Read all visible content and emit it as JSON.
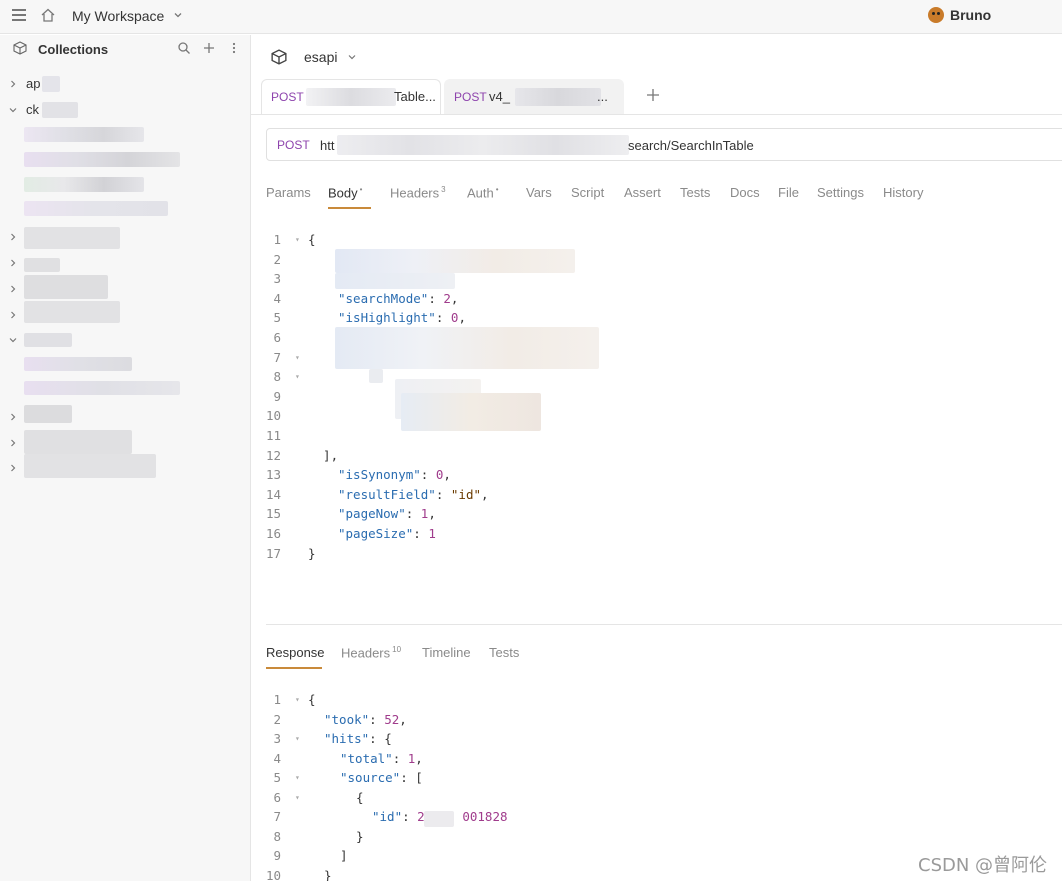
{
  "topbar": {
    "workspace": "My Workspace",
    "brand": "Bruno"
  },
  "sidebar": {
    "title": "Collections",
    "items": [
      {
        "label": "ap",
        "expanded": false
      },
      {
        "label": "ck",
        "expanded": true
      }
    ]
  },
  "collection": {
    "name": "esapi"
  },
  "tabs": [
    {
      "method": "POST",
      "title": "Table...",
      "active": true
    },
    {
      "method": "POST",
      "title": "v4_",
      "title_suffix": "...",
      "active": false
    }
  ],
  "url": {
    "method": "POST",
    "prefix": "htt",
    "suffix": "search/SearchInTable"
  },
  "request_tabs": [
    {
      "label": "Params"
    },
    {
      "label": "Body",
      "badge": "•",
      "active": true
    },
    {
      "label": "Headers",
      "badge": "3"
    },
    {
      "label": "Auth",
      "badge": "•"
    },
    {
      "label": "Vars"
    },
    {
      "label": "Script"
    },
    {
      "label": "Assert"
    },
    {
      "label": "Tests"
    },
    {
      "label": "Docs"
    },
    {
      "label": "File"
    },
    {
      "label": "Settings"
    },
    {
      "label": "History"
    }
  ],
  "body_lines": [
    {
      "n": "1",
      "text": "{"
    },
    {
      "n": "2",
      "text": ""
    },
    {
      "n": "3",
      "text": ""
    },
    {
      "n": "4",
      "key": "\"searchMode\"",
      "val": "2",
      "trail": ","
    },
    {
      "n": "5",
      "key": "\"isHighlight\"",
      "val": "0",
      "trail": ","
    },
    {
      "n": "6",
      "text": ""
    },
    {
      "n": "7",
      "text": ""
    },
    {
      "n": "8",
      "text": ""
    },
    {
      "n": "9",
      "text": ""
    },
    {
      "n": "10",
      "text": ""
    },
    {
      "n": "11",
      "text": ""
    },
    {
      "n": "12",
      "text": "  ],"
    },
    {
      "n": "13",
      "key": "\"isSynonym\"",
      "val": "0",
      "trail": ","
    },
    {
      "n": "14",
      "key": "\"resultField\"",
      "str": "\"id\"",
      "trail": ","
    },
    {
      "n": "15",
      "key": "\"pageNow\"",
      "val": "1",
      "trail": ","
    },
    {
      "n": "16",
      "key": "\"pageSize\"",
      "val": "1",
      "trail": ""
    },
    {
      "n": "17",
      "text": "}"
    }
  ],
  "response_tabs": [
    {
      "label": "Response",
      "active": true
    },
    {
      "label": "Headers",
      "badge": "10"
    },
    {
      "label": "Timeline"
    },
    {
      "label": "Tests"
    }
  ],
  "response_lines": [
    {
      "n": "1",
      "text": "{"
    },
    {
      "n": "2",
      "indent": 1,
      "key": "\"took\"",
      "val": "52",
      "trail": ","
    },
    {
      "n": "3",
      "indent": 1,
      "key": "\"hits\"",
      "text2": "{"
    },
    {
      "n": "4",
      "indent": 2,
      "key": "\"total\"",
      "val": "1",
      "trail": ","
    },
    {
      "n": "5",
      "indent": 2,
      "key": "\"source\"",
      "text2": "["
    },
    {
      "n": "6",
      "indent": 3,
      "text": "{"
    },
    {
      "n": "7",
      "indent": 4,
      "key": "\"id\"",
      "val": "2",
      "val2": "001828"
    },
    {
      "n": "8",
      "indent": 3,
      "text": "}"
    },
    {
      "n": "9",
      "indent": 2,
      "text": "]"
    },
    {
      "n": "10",
      "indent": 1,
      "text": "}"
    }
  ],
  "watermark": "CSDN @曾阿伦",
  "colors": {
    "method": "#8e44ad",
    "accent": "#c98a3a",
    "key": "#2a6cb0",
    "number": "#a03c8c"
  }
}
